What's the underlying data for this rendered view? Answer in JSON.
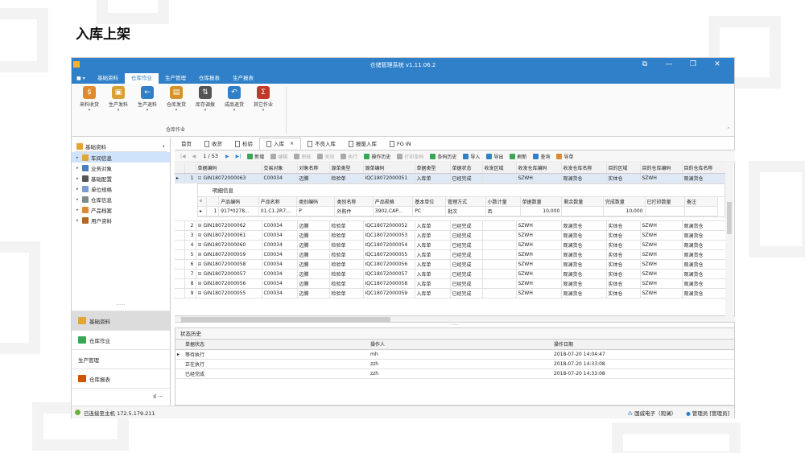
{
  "slide_title": "入库上架",
  "app": {
    "title": "仓储管理系统 v1.11.06.2",
    "window_buttons": [
      "⧉",
      "—",
      "❐",
      "✕"
    ]
  },
  "menu": {
    "items": [
      "基础资料",
      "仓库作业",
      "生产管理",
      "仓库报表",
      "生产报表"
    ],
    "active": "仓库作业"
  },
  "ribbon": {
    "buttons": [
      {
        "label": "来料收货",
        "icon": "receive-icon",
        "color": "#e08a2e",
        "glyph": "$"
      },
      {
        "label": "生产发料",
        "icon": "box-icon",
        "color": "#d9a032",
        "glyph": "▣"
      },
      {
        "label": "生产退料",
        "icon": "arrow-left-icon",
        "color": "#2f80c8",
        "glyph": "←"
      },
      {
        "label": "仓库发货",
        "icon": "truck-icon",
        "color": "#d6922a",
        "glyph": "▤"
      },
      {
        "label": "库存调拨",
        "icon": "transfer-icon",
        "color": "#555555",
        "glyph": "⇅"
      },
      {
        "label": "成品退货",
        "icon": "return-icon",
        "color": "#2f80c8",
        "glyph": "↶"
      },
      {
        "label": "其它作业",
        "icon": "sigma-icon",
        "color": "#c0392b",
        "glyph": "Σ"
      }
    ],
    "group_label": "仓库作业"
  },
  "sidebar": {
    "header": "基础资料",
    "items": [
      {
        "label": "车间信息",
        "color": "#e3a53a"
      },
      {
        "label": "业务对象",
        "color": "#4a7fc1"
      },
      {
        "label": "基础配置",
        "color": "#555555"
      },
      {
        "label": "单位规格",
        "color": "#7a9ccf"
      },
      {
        "label": "仓库信息",
        "color": "#7f8c8d"
      },
      {
        "label": "产品档案",
        "color": "#e08a2e"
      },
      {
        "label": "用户资料",
        "color": "#b5651d"
      }
    ],
    "dots": "......",
    "nav": [
      {
        "label": "基础资料",
        "color": "#e3a53a"
      },
      {
        "label": "仓库作业",
        "color": "#3aa655"
      },
      {
        "label": "生产管理",
        "color": ""
      },
      {
        "label": "仓库报表",
        "color": "#d35400"
      }
    ],
    "bottom": "ıl ···"
  },
  "tabs": [
    "首页",
    "收货",
    "检验",
    "入库",
    "不良入库",
    "报废入库",
    "FG IN"
  ],
  "toolbar": {
    "pager": "1 / 53",
    "buttons": [
      {
        "label": "新增",
        "disabled": false,
        "color": "#3aa655"
      },
      {
        "label": "编辑",
        "disabled": true,
        "color": "#aaaaaa"
      },
      {
        "label": "审核",
        "disabled": true,
        "color": "#aaaaaa"
      },
      {
        "label": "关闭",
        "disabled": true,
        "color": "#aaaaaa"
      },
      {
        "label": "执行",
        "disabled": true,
        "color": "#aaaaaa"
      },
      {
        "label": "操作历史",
        "disabled": false,
        "color": "#3aa655"
      },
      {
        "label": "打印条码",
        "disabled": true,
        "color": "#aaaaaa"
      },
      {
        "label": "条码历史",
        "disabled": false,
        "color": "#3aa655"
      },
      {
        "label": "导入",
        "disabled": false,
        "color": "#2f80c8"
      },
      {
        "label": "导出",
        "disabled": false,
        "color": "#2f80c8"
      },
      {
        "label": "刷新",
        "disabled": false,
        "color": "#3aa655"
      },
      {
        "label": "查询",
        "disabled": false,
        "color": "#2f80c8"
      },
      {
        "label": "导单",
        "disabled": false,
        "color": "#e08a2e"
      }
    ]
  },
  "grid": {
    "columns": [
      "单据编码",
      "交易对象",
      "对象名称",
      "源单类型",
      "源单编码",
      "单据类型",
      "单据状态",
      "收发区域",
      "收发仓库编码",
      "收发仓库名称",
      "目的区域",
      "目的仓库编码",
      "目的仓库名称"
    ],
    "rows": [
      {
        "num": "1",
        "cells": [
          "GIN18072000063",
          "C00034",
          "迈腾",
          "检验单",
          "IQC18072000051",
          "入库单",
          "已经完成",
          "",
          "SZWH",
          "观澜货仓",
          "实体仓",
          "SZWH",
          "观澜货仓"
        ]
      },
      {
        "num": "2",
        "cells": [
          "GIN18072000062",
          "C00034",
          "迈腾",
          "检验单",
          "IQC18072000052",
          "入库单",
          "已经完成",
          "",
          "SZWH",
          "观澜货仓",
          "实体仓",
          "SZWH",
          "观澜货仓"
        ]
      },
      {
        "num": "3",
        "cells": [
          "GIN18072000061",
          "C00034",
          "迈腾",
          "检验单",
          "IQC18072000053",
          "入库单",
          "已经完成",
          "",
          "SZWH",
          "观澜货仓",
          "实体仓",
          "SZWH",
          "观澜货仓"
        ]
      },
      {
        "num": "4",
        "cells": [
          "GIN18072000060",
          "C00034",
          "迈腾",
          "检验单",
          "IQC18072000054",
          "入库单",
          "已经完成",
          "",
          "SZWH",
          "观澜货仓",
          "实体仓",
          "SZWH",
          "观澜货仓"
        ]
      },
      {
        "num": "5",
        "cells": [
          "GIN18072000059",
          "C00034",
          "迈腾",
          "检验单",
          "IQC18072000055",
          "入库单",
          "已经完成",
          "",
          "SZWH",
          "观澜货仓",
          "实体仓",
          "SZWH",
          "观澜货仓"
        ]
      },
      {
        "num": "6",
        "cells": [
          "GIN18072000058",
          "C00034",
          "迈腾",
          "检验单",
          "IQC18072000056",
          "入库单",
          "已经完成",
          "",
          "SZWH",
          "观澜货仓",
          "实体仓",
          "SZWH",
          "观澜货仓"
        ]
      },
      {
        "num": "7",
        "cells": [
          "GIN18072000057",
          "C00034",
          "迈腾",
          "检验单",
          "IQC18072000057",
          "入库单",
          "已经完成",
          "",
          "SZWH",
          "观澜货仓",
          "实体仓",
          "SZWH",
          "观澜货仓"
        ]
      },
      {
        "num": "8",
        "cells": [
          "GIN18072000056",
          "C00034",
          "迈腾",
          "检验单",
          "IQC18072000058",
          "入库单",
          "已经完成",
          "",
          "SZWH",
          "观澜货仓",
          "实体仓",
          "SZWH",
          "观澜货仓"
        ]
      },
      {
        "num": "9",
        "cells": [
          "GIN18072000055",
          "C00034",
          "迈腾",
          "检验单",
          "IQC18072000059",
          "入库单",
          "已经完成",
          "",
          "SZWH",
          "观澜货仓",
          "实体仓",
          "SZWH",
          "观澜货仓"
        ]
      }
    ]
  },
  "detail": {
    "title": "明细信息",
    "columns": [
      "产品编码",
      "产品名称",
      "类别编码",
      "类别名称",
      "产品规格",
      "基本单位",
      "管理方式",
      "小数计量",
      "单据数量",
      "剩余数量",
      "完成数量",
      "已打印数量",
      "备注"
    ],
    "row": {
      "num": "1",
      "cells": [
        "917*0278...",
        "01.C1.2R7...",
        "P",
        "外购件",
        "3902,CAP...",
        "PC",
        "批次",
        "否",
        "10,000",
        "",
        "10,000",
        "",
        ""
      ]
    }
  },
  "status_history": {
    "tab": "状态历史",
    "columns": [
      "单据状态",
      "操作人",
      "操作日期"
    ],
    "rows": [
      [
        "等待执行",
        "mh",
        "2018-07-20 14:04:47"
      ],
      [
        "正在执行",
        "zzh",
        "2018-07-20 14:33:08"
      ],
      [
        "已经完成",
        "zzh",
        "2018-07-20 14:33:08"
      ]
    ]
  },
  "statusbar": {
    "connection": "已连接至主机 172.5.179.211",
    "company": "国威电子（观澜）",
    "user": "管理员 [管理员]"
  }
}
